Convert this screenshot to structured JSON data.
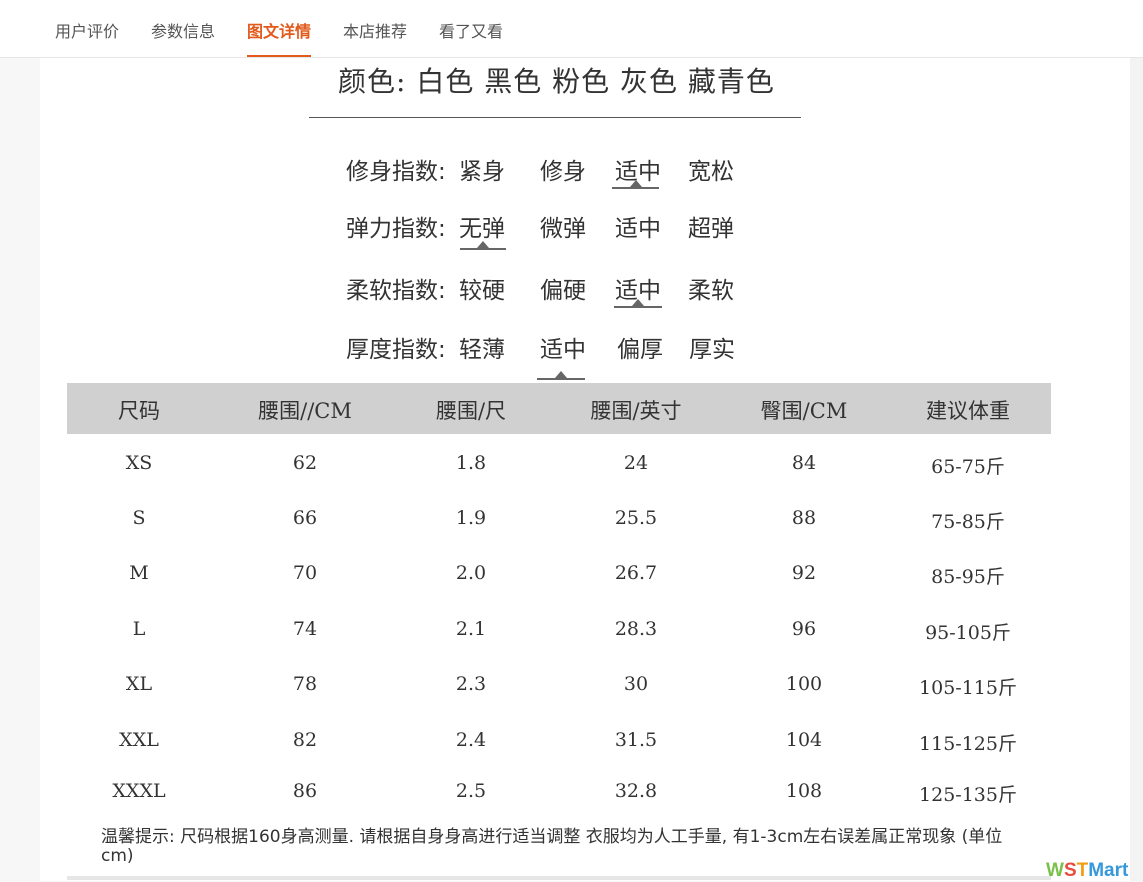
{
  "tabs": [
    {
      "label": "用户评价",
      "active": false
    },
    {
      "label": "参数信息",
      "active": false
    },
    {
      "label": "图文详情",
      "active": true
    },
    {
      "label": "本店推荐",
      "active": false
    },
    {
      "label": "看了又看",
      "active": false
    }
  ],
  "colors_line": "颜色: 白色 黑色 粉色 灰色 藏青色",
  "indices": [
    {
      "label": "修身指数:",
      "options": [
        "紧身",
        "修身",
        "适中",
        "宽松"
      ],
      "selected": "适中"
    },
    {
      "label": "弹力指数:",
      "options": [
        "无弹",
        "微弹",
        "适中",
        "超弹"
      ],
      "selected": "无弹"
    },
    {
      "label": "柔软指数:",
      "options": [
        "较硬",
        "偏硬",
        "适中",
        "柔软"
      ],
      "selected": "适中"
    },
    {
      "label": "厚度指数:",
      "options": [
        "轻薄",
        "适中",
        "偏厚",
        "厚实"
      ],
      "selected": "适中"
    }
  ],
  "size_table": {
    "headers": [
      "尺码",
      "腰围//CM",
      "腰围/尺",
      "腰围/英寸",
      "臀围/CM",
      "建议体重"
    ],
    "rows": [
      [
        "XS",
        "62",
        "1.8",
        "24",
        "84",
        "65-75斤"
      ],
      [
        "S",
        "66",
        "1.9",
        "25.5",
        "88",
        "75-85斤"
      ],
      [
        "M",
        "70",
        "2.0",
        "26.7",
        "92",
        "85-95斤"
      ],
      [
        "L",
        "74",
        "2.1",
        "28.3",
        "96",
        "95-105斤"
      ],
      [
        "XL",
        "78",
        "2.3",
        "30",
        "100",
        "105-115斤"
      ],
      [
        "XXL",
        "82",
        "2.4",
        "31.5",
        "104",
        "115-125斤"
      ],
      [
        "XXXL",
        "86",
        "2.5",
        "32.8",
        "108",
        "125-135斤"
      ]
    ]
  },
  "tip": "温馨提示: 尺码根据160身高测量. 请根据自身身高进行适当调整 衣服均为人工手量, 有1-3cm左右误差属正常现象 (单位cm)",
  "watermark": {
    "w": "W",
    "s": "S",
    "t": "T",
    "rest": "Mart"
  },
  "accent_color": "#e25a1c"
}
